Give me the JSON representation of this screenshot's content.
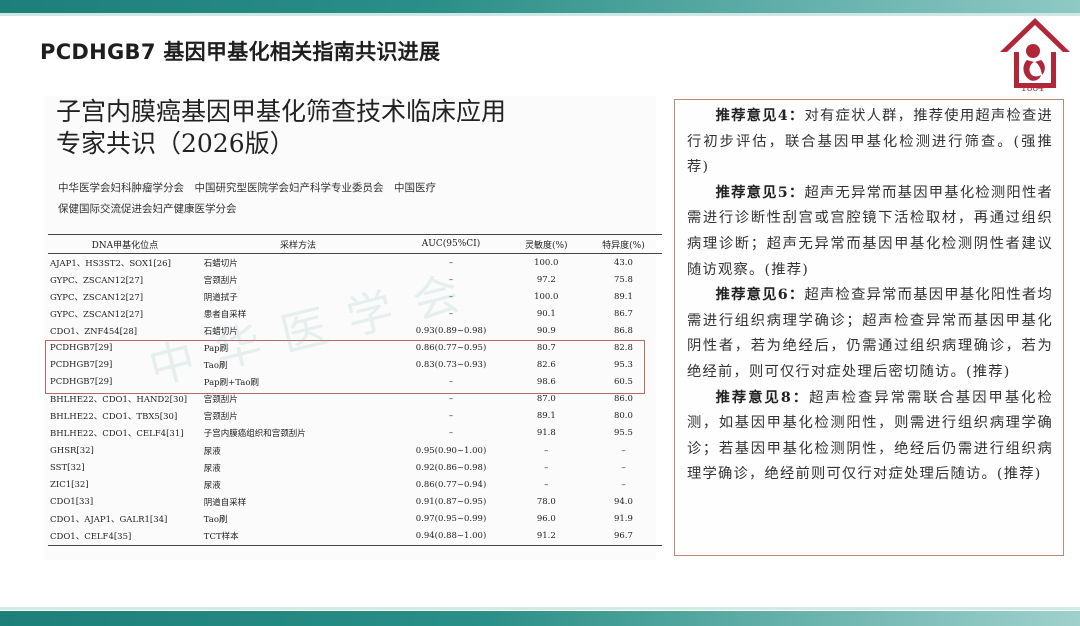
{
  "slide": {
    "title": "PCDHGB7 基因甲基化相关指南共识进展",
    "logo_year": "1884"
  },
  "document": {
    "title_line1": "子宫内膜癌基因甲基化筛查技术临床应用",
    "title_line2": "专家共识（2026版）",
    "orgs_line1": "中华医学会妇科肿瘤学分会　中国研究型医院学会妇产科学专业委员会　中国医疗",
    "orgs_line2": "保健国际交流促进会妇产健康医学分会",
    "watermark": "中华医学会",
    "table": {
      "headers": [
        "DNA甲基化位点",
        "采样方法",
        "AUC(95%CI)",
        "灵敏度(%)",
        "特异度(%)"
      ],
      "rows": [
        [
          "AJAP1、HS3ST2、SOX1[26]",
          "石蜡切片",
          "–",
          "100.0",
          "43.0"
        ],
        [
          "GYPC、ZSCAN12[27]",
          "宫颈刮片",
          "–",
          "97.2",
          "75.8"
        ],
        [
          "GYPC、ZSCAN12[27]",
          "阴道拭子",
          "–",
          "100.0",
          "89.1"
        ],
        [
          "GYPC、ZSCAN12[27]",
          "患者自采样",
          "–",
          "90.1",
          "86.7"
        ],
        [
          "CDO1、ZNF454[28]",
          "石蜡切片",
          "0.93(0.89~0.98)",
          "90.9",
          "86.8"
        ],
        [
          "PCDHGB7[29]",
          "Pap刷",
          "0.86(0.77~0.95)",
          "80.7",
          "82.8"
        ],
        [
          "PCDHGB7[29]",
          "Tao刷",
          "0.83(0.73~0.93)",
          "82.6",
          "95.3"
        ],
        [
          "PCDHGB7[29]",
          "Pap刷+Tao刷",
          "–",
          "98.6",
          "60.5"
        ],
        [
          "BHLHE22、CDO1、HAND2[30]",
          "宫颈刮片",
          "–",
          "87.0",
          "86.0"
        ],
        [
          "BHLHE22、CDO1、TBX5[30]",
          "宫颈刮片",
          "–",
          "89.1",
          "80.0"
        ],
        [
          "BHLHE22、CDO1、CELF4[31]",
          "子宫内膜癌组织和宫颈刮片",
          "–",
          "91.8",
          "95.5"
        ],
        [
          "GHSR[32]",
          "尿液",
          "0.95(0.90~1.00)",
          "–",
          "–"
        ],
        [
          "SST[32]",
          "尿液",
          "0.92(0.86~0.98)",
          "–",
          "–"
        ],
        [
          "ZIC1[32]",
          "尿液",
          "0.86(0.77~0.94)",
          "–",
          "–"
        ],
        [
          "CDO1[33]",
          "阴道自采样",
          "0.91(0.87~0.95)",
          "78.0",
          "94.0"
        ],
        [
          "CDO1、AJAP1、GALR1[34]",
          "Tao刷",
          "0.97(0.95~0.99)",
          "96.0",
          "91.9"
        ],
        [
          "CDO1、CELF4[35]",
          "TCT样本",
          "0.94(0.88~1.00)",
          "91.2",
          "96.7"
        ]
      ]
    }
  },
  "recommendations": [
    {
      "label": "推荐意见4：",
      "text": "对有症状人群，推荐使用超声检查进行初步评估，联合基因甲基化检测进行筛查。(强推荐)"
    },
    {
      "label": "推荐意见5：",
      "text": "超声无异常而基因甲基化检测阳性者需进行诊断性刮宫或宫腔镜下活检取材，再通过组织病理诊断；超声无异常而基因甲基化检测阴性者建议随访观察。(推荐)"
    },
    {
      "label": "推荐意见6：",
      "text": "超声检查异常而基因甲基化阳性者均需进行组织病理学确诊；超声检查异常而基因甲基化阴性者，若为绝经后，仍需通过组织病理确诊，若为绝经前，则可仅行对症处理后密切随访。(推荐)"
    },
    {
      "label": "推荐意见8：",
      "text": "超声检查异常需联合基因甲基化检测，如基因甲基化检测阳性，则需进行组织病理学确诊；若基因甲基化检测阴性，绝经后仍需进行组织病理学确诊，绝经前则可仅行对症处理后随访。(推荐)"
    }
  ],
  "colors": {
    "accent_teal": "#1d7f7a",
    "logo_red": "#b0273a",
    "highlight_border": "#b86868"
  }
}
